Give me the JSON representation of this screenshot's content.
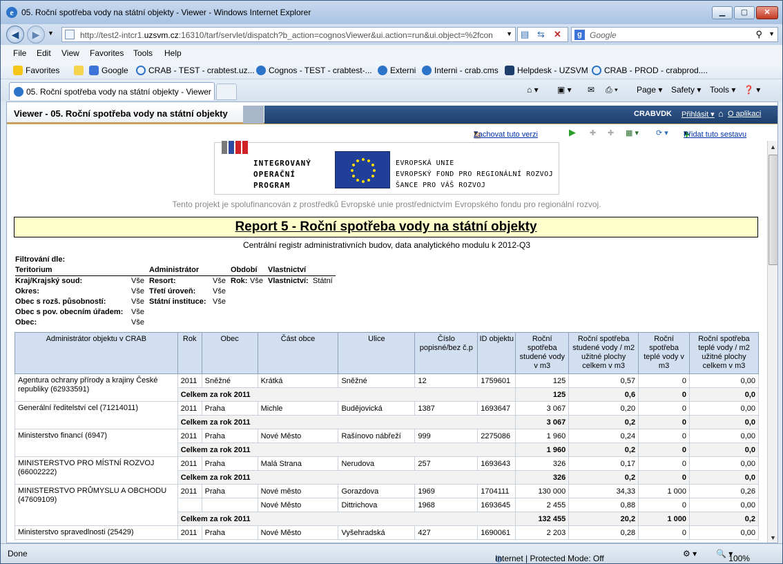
{
  "window": {
    "title": "05. Roční spotřeba vody na státní objekty - Viewer - Windows Internet Explorer"
  },
  "address": {
    "url_prefix": "http://test2-intcr1.",
    "url_host": "uzsvm.cz",
    "url_rest": ":16310/tarf/servlet/dispatch?b_action=cognosViewer&ui.action=run&ui.object=%2fcon"
  },
  "search": {
    "placeholder": "Google"
  },
  "menu": [
    "File",
    "Edit",
    "View",
    "Favorites",
    "Tools",
    "Help"
  ],
  "favorites": {
    "label": "Favorites",
    "items": [
      "Google",
      "CRAB - TEST - crabtest.uz...",
      "Cognos - TEST - crabtest-...",
      "Externi",
      "Interni - crab.cms",
      "Helpdesk - UZSVM",
      "CRAB - PROD - crabprod...."
    ]
  },
  "tab": {
    "title": "05. Roční spotřeba vody na státní objekty - Viewer"
  },
  "commandbar": {
    "page": "Page",
    "safety": "Safety",
    "tools": "Tools"
  },
  "viewer": {
    "title": "Viewer - 05. Roční spotřeba vody na státní objekty",
    "user": "CRABVDK",
    "login": "Přihlásit",
    "about": "O aplikaci",
    "keep_version": "Zachovat tuto verzi",
    "add_report": "Přidat tuto sestavu"
  },
  "logo": {
    "iop": [
      "INTEGROVANÝ",
      "OPERAČNÍ",
      "PROGRAM"
    ],
    "eu": [
      "EVROPSKÁ UNIE",
      "EVROPSKÝ FOND PRO REGIONÁLNÍ ROZVOJ",
      "ŠANCE PRO VÁŠ ROZVOJ"
    ]
  },
  "report": {
    "cofinance": "Tento projekt je spolufinancován z prostředků Evropské unie prostřednictvím Evropského fondu pro regionální rozvoj.",
    "title": "Report 5 - Roční spotřeba vody na státní objekty",
    "subtitle": "Centrální registr administrativních budov, data analytického modulu k 2012-Q3",
    "filter": {
      "heading": "Filtrování dle:",
      "teritorium": "Teritorium",
      "administrator": "Administrátor",
      "obdobi": "Období",
      "vlastnictvi": "Vlastnictví",
      "kraj": "Kraj/Krajský soud:",
      "okres": "Okres:",
      "obec_rozs": "Obec s rozš. působností:",
      "obec_pov": "Obec s pov. obecním úřadem:",
      "obec": "Obec:",
      "resort": "Resort:",
      "treti": "Třetí úroveň:",
      "statni": "Státní instituce:",
      "rok": "Rok:",
      "vlastnictvi_label": "Vlastnictví:",
      "vse": "Vše",
      "statni_val": "Státní"
    },
    "columns": [
      "Administrátor objektu v CRAB",
      "Rok",
      "Obec",
      "Část obce",
      "Ulice",
      "Číslo popisné/bez č.p",
      "ID objektu",
      "Roční spotřeba studené vody v m3",
      "Roční spotřeba studené vody / m2 užitné plochy celkem v m3",
      "Roční spotřeba teplé vody v m3",
      "Roční spotřeba teplé vody / m2 užitné plochy celkem v m3"
    ],
    "total_label": "Celkem za rok 2011",
    "groups": [
      {
        "admin": "Agentura ochrany přírody a krajiny České republiky (62933591)",
        "rows": [
          [
            "2011",
            "Sněžné",
            "Krátká",
            "Sněžné",
            "12",
            "1759601",
            "125",
            "0,57",
            "0",
            "0,00"
          ]
        ],
        "total": [
          "125",
          "0,6",
          "0",
          "0,0"
        ]
      },
      {
        "admin": "Generální ředitelství cel (71214011)",
        "rows": [
          [
            "2011",
            "Praha",
            "Michle",
            "Budějovická",
            "1387",
            "1693647",
            "3 067",
            "0,20",
            "0",
            "0,00"
          ]
        ],
        "total": [
          "3 067",
          "0,2",
          "0",
          "0,0"
        ]
      },
      {
        "admin": "Ministerstvo financí (6947)",
        "rows": [
          [
            "2011",
            "Praha",
            "Nové Město",
            "Rašínovo nábřeží",
            "999",
            "2275086",
            "1 960",
            "0,24",
            "0",
            "0,00"
          ]
        ],
        "total": [
          "1 960",
          "0,2",
          "0",
          "0,0"
        ]
      },
      {
        "admin": "MINISTERSTVO PRO MÍSTNÍ ROZVOJ (66002222)",
        "rows": [
          [
            "2011",
            "Praha",
            "Malá Strana",
            "Nerudova",
            "257",
            "1693643",
            "326",
            "0,17",
            "0",
            "0,00"
          ]
        ],
        "total": [
          "326",
          "0,2",
          "0",
          "0,0"
        ]
      },
      {
        "admin": "MINISTERSTVO PRŮMYSLU A OBCHODU (47609109)",
        "rows": [
          [
            "2011",
            "Praha",
            "Nové město",
            "Gorazdova",
            "1969",
            "1704111",
            "130 000",
            "34,33",
            "1 000",
            "0,26"
          ],
          [
            "",
            "",
            "Nové Město",
            "Dittrichova",
            "1968",
            "1693645",
            "2 455",
            "0,88",
            "0",
            "0,00"
          ]
        ],
        "total": [
          "132 455",
          "20,2",
          "1 000",
          "0,2"
        ]
      },
      {
        "admin": "Ministerstvo spravedlnosti (25429)",
        "rows": [
          [
            "2011",
            "Praha",
            "Nové Město",
            "Vyšehradská",
            "427",
            "1690061",
            "2 203",
            "0,28",
            "0",
            "0,00"
          ]
        ],
        "total": null
      }
    ]
  },
  "status": {
    "left": "Done",
    "zone": "Internet | Protected Mode: Off",
    "zoom": "100%"
  }
}
